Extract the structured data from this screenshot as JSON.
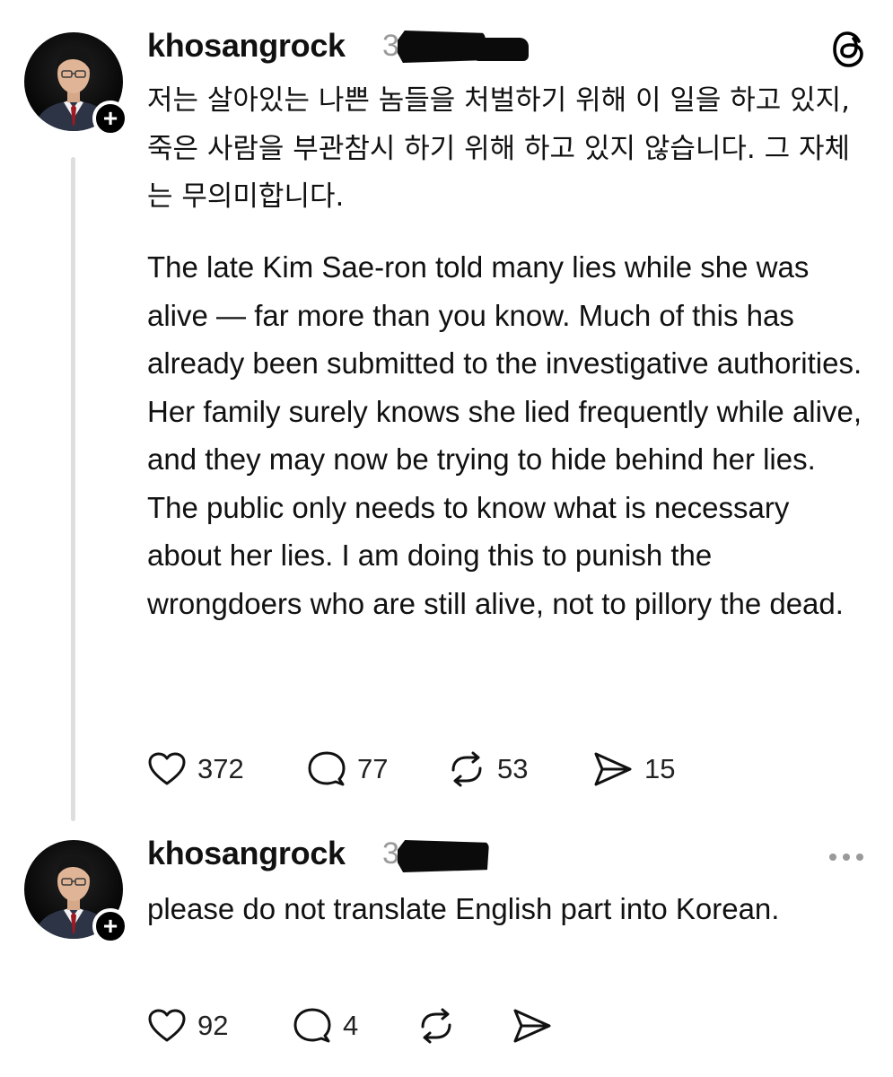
{
  "posts": [
    {
      "username": "khosangrock",
      "time": "3",
      "korean_text": "저는 살아있는 나쁜 놈들을 처벌하기 위해 이 일을 하고 있지, 죽은 사람을 부관참시 하기 위해 하고 있지 않습니다. 그 자체는 무의미합니다.",
      "english_text": "The late Kim Sae-ron told many lies while she was alive — far more than you know. Much of this has already been submitted to the investigative authorities. Her family surely knows she lied frequently while alive, and they may now be trying to hide behind her lies. The public only needs to know what is necessary about her lies. I am doing this to punish the wrongdoers who are still alive, not to pillory the dead.",
      "likes": "372",
      "replies": "77",
      "reposts": "53",
      "shares": "15"
    },
    {
      "username": "khosangrock",
      "time": "3",
      "text": "please do not translate English part into Korean.",
      "likes": "92",
      "replies": "4",
      "reposts": "",
      "shares": ""
    }
  ],
  "icons": {
    "app_logo": "threads-logo-icon",
    "more": "more-options-icon",
    "like": "heart-icon",
    "reply": "comment-icon",
    "repost": "repost-icon",
    "share": "share-icon",
    "follow": "plus-icon"
  },
  "colors": {
    "text": "#111111",
    "muted": "#9a9a9a",
    "thread_line": "#dedede"
  }
}
